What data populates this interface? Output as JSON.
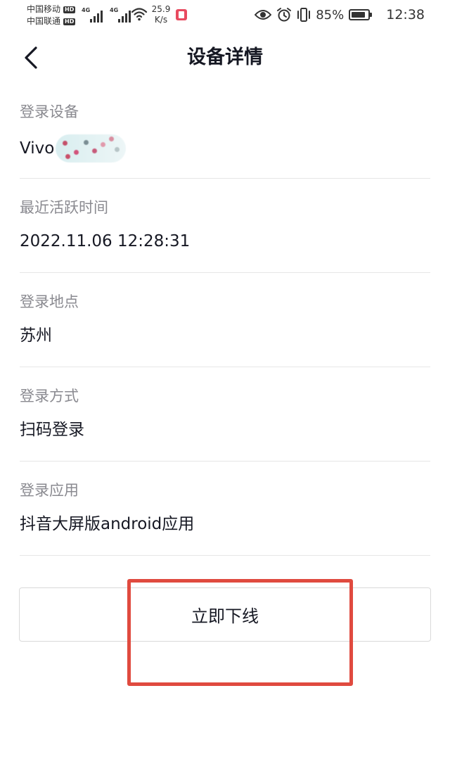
{
  "status_bar": {
    "carrier_1": "中国移动",
    "carrier_2": "中国联通",
    "hd_badge": "HD",
    "network_1": "4G",
    "network_2": "4G",
    "speed_value": "25.9",
    "speed_unit": "K/s",
    "battery_percent": "85%",
    "battery_level": 0.85,
    "time": "12:38",
    "icons": [
      "eye-icon",
      "alarm-icon",
      "vibrate-icon",
      "battery-icon",
      "wifi-icon",
      "signal-icon"
    ]
  },
  "header": {
    "title": "设备详情",
    "back_icon": "chevron-left-icon"
  },
  "details": [
    {
      "label": "登录设备",
      "value": "Vivo"
    },
    {
      "label": "最近活跃时间",
      "value": "2022.11.06 12:28:31"
    },
    {
      "label": "登录地点",
      "value": "苏州"
    },
    {
      "label": "登录方式",
      "value": "扫码登录"
    },
    {
      "label": "登录应用",
      "value": "抖音大屏版android应用"
    }
  ],
  "logout_button": {
    "label": "立即下线"
  },
  "colors": {
    "title_text": "#161823",
    "label_text": "#8a8a90",
    "divider": "#e6e6e6",
    "highlight": "#e04a3f"
  }
}
